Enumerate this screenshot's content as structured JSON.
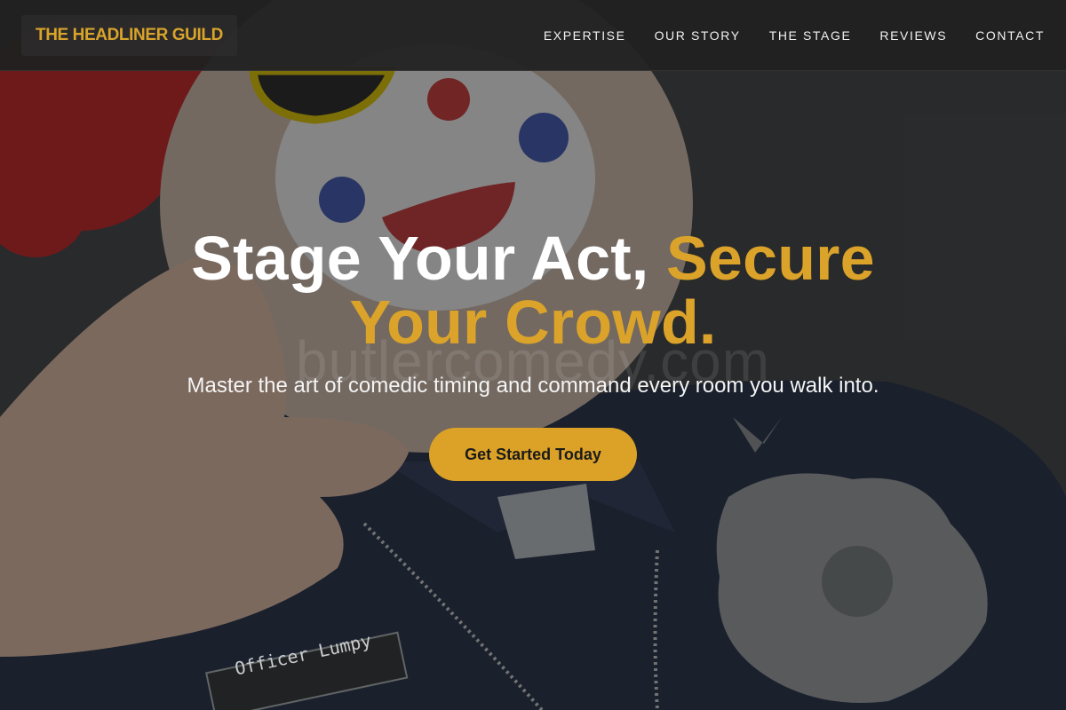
{
  "brand": {
    "name": "THE HEADLINER GUILD",
    "color": "#d9a42a"
  },
  "nav": {
    "items": [
      {
        "label": "EXPERTISE"
      },
      {
        "label": "OUR STORY"
      },
      {
        "label": "THE STAGE"
      },
      {
        "label": "REVIEWS"
      },
      {
        "label": "CONTACT"
      }
    ]
  },
  "hero": {
    "headline_white": "Stage Your Act, ",
    "headline_accent": "Secure Your Crowd.",
    "subheadline": "Master the art of comedic timing and command every room you walk into.",
    "cta_label": "Get Started Today",
    "accent_color": "#dba32a"
  },
  "background": {
    "watermark": "butlercomedy.com",
    "name_tag": "Officer Lumpy"
  }
}
